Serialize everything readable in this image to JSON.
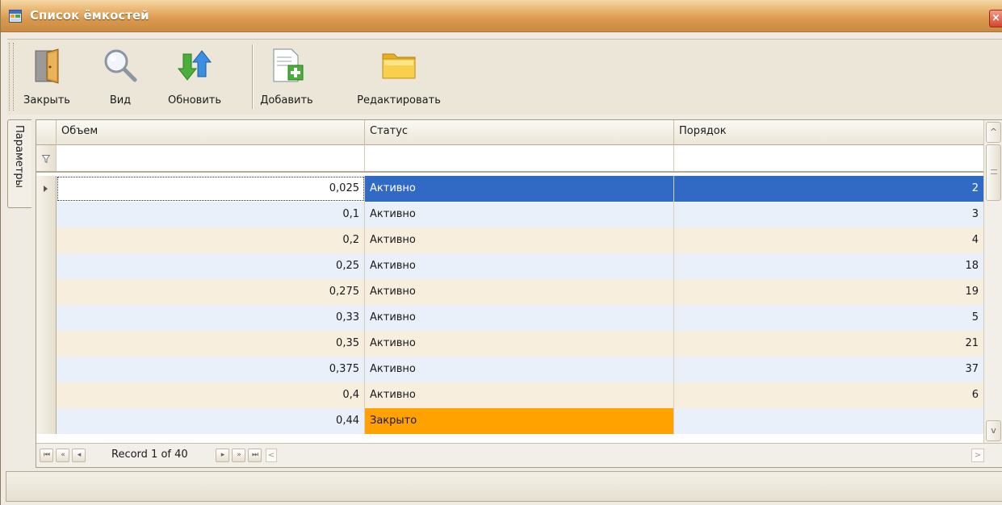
{
  "window": {
    "title": "Список ёмкостей",
    "close_glyph": "×",
    "app_icon": "window-app-icon"
  },
  "toolbar": {
    "buttons": [
      {
        "label": "Закрыть",
        "icon": "door-exit-icon"
      },
      {
        "label": "Вид",
        "icon": "magnifier-icon"
      },
      {
        "label": "Обновить",
        "icon": "refresh-arrows-icon"
      },
      {
        "label": "Добавить",
        "icon": "add-document-icon"
      },
      {
        "label": "Редактировать",
        "icon": "folder-edit-icon"
      }
    ]
  },
  "side_tab": {
    "label": "Параметры"
  },
  "grid": {
    "columns": [
      "Объем",
      "Статус",
      "Порядок"
    ],
    "filter_icon": "filter-funnel-icon",
    "rows": [
      {
        "volume": "0,025",
        "status": "Активно",
        "order": "2",
        "selected": true
      },
      {
        "volume": "0,1",
        "status": "Активно",
        "order": "3"
      },
      {
        "volume": "0,2",
        "status": "Активно",
        "order": "4"
      },
      {
        "volume": "0,25",
        "status": "Активно",
        "order": "18"
      },
      {
        "volume": "0,275",
        "status": "Активно",
        "order": "19"
      },
      {
        "volume": "0,33",
        "status": "Активно",
        "order": "5"
      },
      {
        "volume": "0,35",
        "status": "Активно",
        "order": "21"
      },
      {
        "volume": "0,375",
        "status": "Активно",
        "order": "37"
      },
      {
        "volume": "0,4",
        "status": "Активно",
        "order": "6"
      },
      {
        "volume": "0,44",
        "status": "Закрыто",
        "order": "",
        "closed": true
      }
    ],
    "colors": {
      "selection": "#316ac5",
      "row_alt_blue": "#e9f0f9",
      "row_alt_beige": "#f8eede",
      "closed_status": "#ffa200"
    }
  },
  "navigator": {
    "record_text": "Record 1 of 40",
    "first_glyph": "⏮",
    "prev_page_glyph": "«",
    "prev_glyph": "◂",
    "next_glyph": "▸",
    "next_page_glyph": "»",
    "last_glyph": "⏭",
    "scroll_left_glyph": "<",
    "scroll_right_glyph": ">"
  },
  "scrollbar": {
    "up_glyph": "^",
    "down_glyph": "v"
  }
}
